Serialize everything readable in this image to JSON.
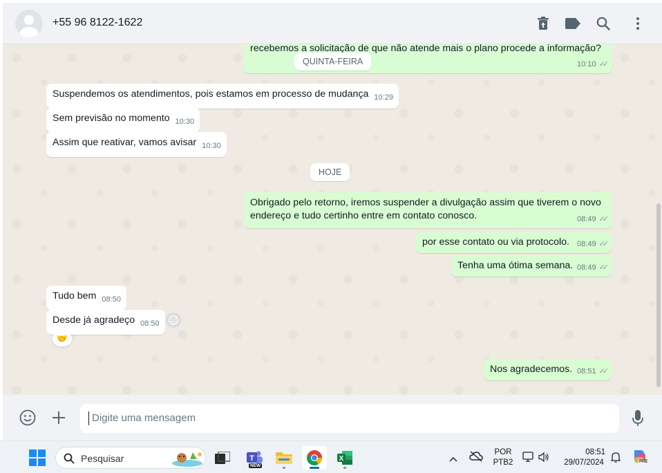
{
  "header": {
    "contact": "+55 96 8122-1622",
    "icons": [
      "delete-icon",
      "label-icon",
      "search-icon",
      "menu-icon"
    ]
  },
  "messages": {
    "m0": {
      "text": "recebemos a solicitação de que não atende mais o plano procede a informação?",
      "time": "10:10",
      "dir": "out"
    },
    "chip1": "QUINTA-FEIRA",
    "m1": {
      "text": "Suspendemos os atendimentos, pois estamos em processo de mudança",
      "time": "10:29"
    },
    "m2": {
      "text": "Sem previsão no momento",
      "time": "10:30"
    },
    "m3": {
      "text": "Assim que reativar, vamos avisar",
      "time": "10:30"
    },
    "chip2": "HOJE",
    "m4": {
      "text": "Obrigado pelo retorno, iremos suspender a divulgação assim que tiverem o novo endereço e tudo certinho entre em contato conosco.",
      "time": "08:49"
    },
    "m5": {
      "text": "por esse contato ou via protocolo.",
      "time": "08:49"
    },
    "m6": {
      "text": "Tenha uma ótima semana.",
      "time": "08:49"
    },
    "m7": {
      "text": "Tudo bem",
      "time": "08:50"
    },
    "m8": {
      "text": "Desde já agradeço",
      "time": "08:50",
      "reaction": "🤝"
    },
    "m9": {
      "text": "Nos agradecemos.",
      "time": "08:51"
    }
  },
  "composer": {
    "placeholder": "Digite uma mensagem",
    "icons": [
      "emoji-icon",
      "plus-icon",
      "mic-icon"
    ]
  },
  "taskbar": {
    "search_label": "Pesquisar",
    "apps": [
      "task-view",
      "teams",
      "file-explorer",
      "chrome",
      "excel"
    ],
    "teams_badge": "NEW",
    "lang_top": "POR",
    "lang_bottom": "PTB2",
    "time": "08:51",
    "date": "29/07/2024",
    "copilot_badge": "PRE"
  },
  "colors": {
    "outgoing": "#d9fdd3",
    "incoming": "#ffffff",
    "chat_bg": "#efeae2",
    "accent": "#0067c0"
  }
}
